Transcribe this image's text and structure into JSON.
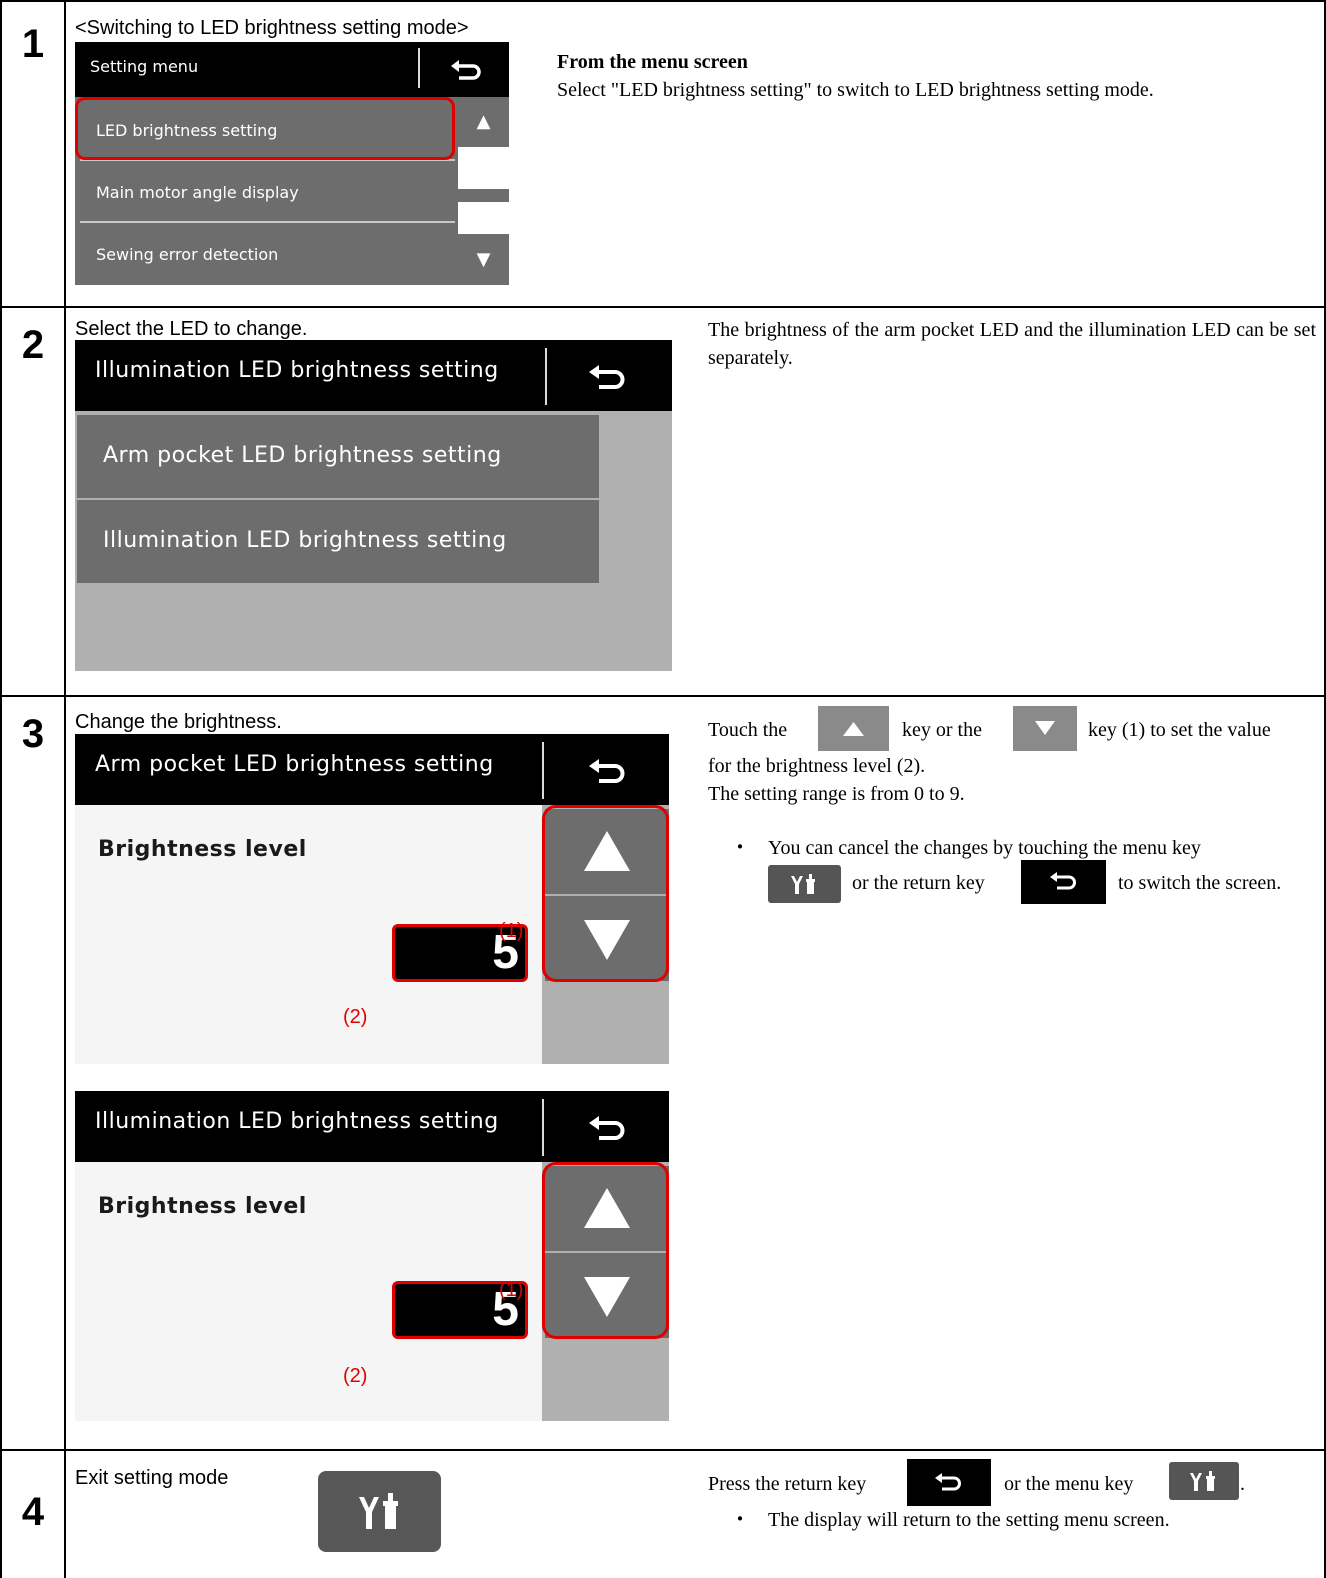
{
  "steps": [
    {
      "number": "1",
      "caption": "<Switching to LED brightness setting mode>",
      "screen": {
        "title": "Setting menu",
        "items": [
          "LED brightness setting",
          "Main motor angle display",
          "Sewing error detection"
        ]
      },
      "heading": "From the menu screen",
      "text": "Select \"LED brightness setting\" to switch to LED brightness setting mode."
    },
    {
      "number": "2",
      "caption": "Select the LED to change.",
      "screen": {
        "title": "Illumination LED brightness setting",
        "items": [
          "Arm pocket LED brightness setting",
          "Illumination LED brightness setting"
        ]
      },
      "text": "The brightness of the arm pocket LED and the illumination LED can be set separately."
    },
    {
      "number": "3",
      "caption": "Change the brightness.",
      "screens": [
        {
          "title": "Arm pocket LED brightness setting",
          "label": "Brightness level",
          "value": "5",
          "callout_keys": "(1)",
          "callout_value": "(2)"
        },
        {
          "title": "Illumination LED brightness setting",
          "label": "Brightness level",
          "value": "5",
          "callout_keys": "(1)",
          "callout_value": "(2)"
        }
      ],
      "text_parts": [
        "Touch the",
        "key or the",
        "key (1) to set the value"
      ],
      "line2": "for the brightness level (2).",
      "line3": "The setting range is from 0 to 9.",
      "bullet": "・",
      "bullet_line1": "You can cancel the changes by touching the menu key",
      "bullet_line2a": "or the return key",
      "bullet_line2b": "to switch the screen."
    },
    {
      "number": "4",
      "caption": "Exit setting mode",
      "text_a": "Press the return key",
      "text_b": "or the menu key",
      "text_c": ".",
      "bullet": "・",
      "bullet_text": "The display will return to the setting menu screen."
    }
  ],
  "icons": {
    "return": "return-arrow-icon",
    "menu": "wrench-screwdriver-icon",
    "up": "triangle-up-icon",
    "down": "triangle-down-icon"
  },
  "colors": {
    "highlight": "#e00000",
    "screen_gray": "#6d6d6d",
    "panel_gray": "#b0b0b0"
  }
}
